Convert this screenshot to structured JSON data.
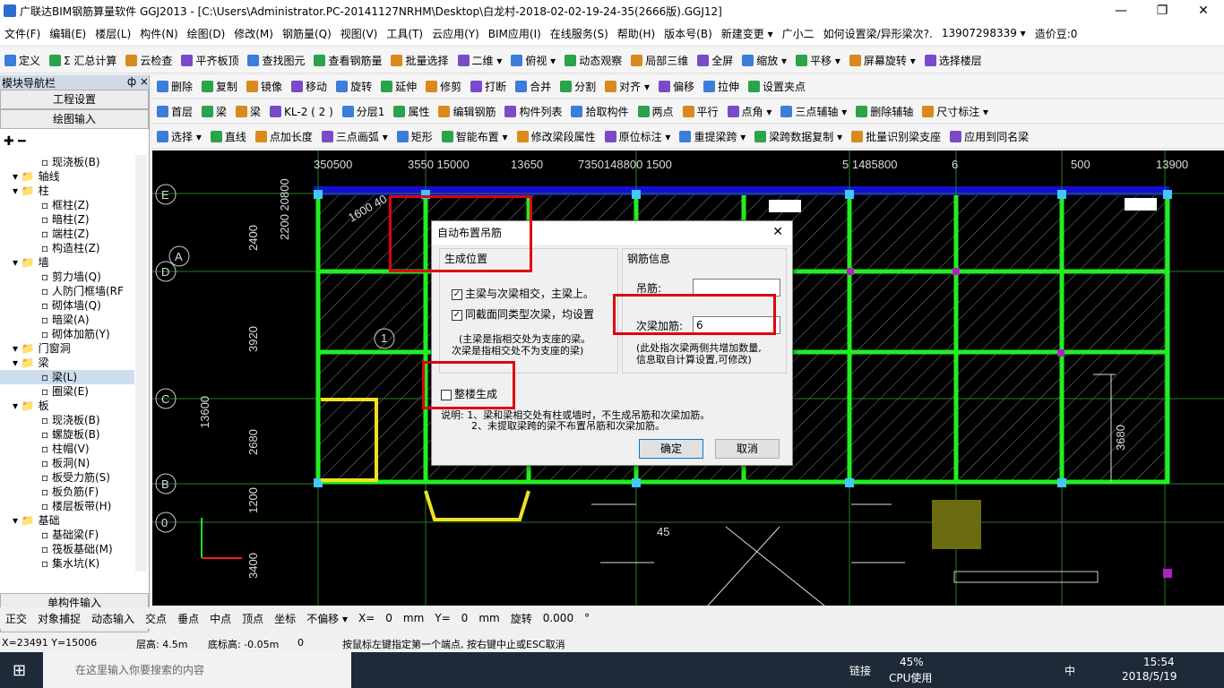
{
  "window": {
    "title": "广联达BIM钢筋算量软件 GGJ2013 - [C:\\Users\\Administrator.PC-20141127NRHM\\Desktop\\白龙村-2018-02-02-19-24-35(2666版).GGJ12]"
  },
  "menu": [
    "文件(F)",
    "编辑(E)",
    "楼层(L)",
    "构件(N)",
    "绘图(D)",
    "修改(M)",
    "钢筋量(Q)",
    "视图(V)",
    "工具(T)",
    "云应用(Y)",
    "BIM应用(I)",
    "在线服务(S)",
    "帮助(H)",
    "版本号(B)",
    "新建变更 ▾",
    "广小二",
    "如何设置梁/异形梁次?.",
    "13907298339 ▾",
    "造价豆:0"
  ],
  "toolbar1": [
    "定义",
    "Σ 汇总计算",
    "云检查",
    "平齐板顶",
    "查找图元",
    "查看钢筋量",
    "批量选择",
    "二维 ▾",
    "俯视 ▾",
    "动态观察",
    "局部三维",
    "全屏",
    "缩放 ▾",
    "平移 ▾",
    "屏幕旋转 ▾",
    "选择楼层"
  ],
  "toolbar2": [
    "删除",
    "复制",
    "镜像",
    "移动",
    "旋转",
    "延伸",
    "修剪",
    "打断",
    "合并",
    "分割",
    "对齐 ▾",
    "偏移",
    "拉伸",
    "设置夹点"
  ],
  "toolbar3": [
    "首层",
    "梁",
    "梁",
    "KL-2 ( 2 )",
    "分层1",
    "属性",
    "编辑钢筋",
    "构件列表",
    "拾取构件",
    "两点",
    "平行",
    "点角 ▾",
    "三点辅轴 ▾",
    "删除辅轴",
    "尺寸标注 ▾"
  ],
  "toolbar4": [
    "选择 ▾",
    "直线",
    "点加长度",
    "三点画弧 ▾",
    "矩形",
    "智能布置 ▾",
    "修改梁段属性",
    "原位标注 ▾",
    "重提梁跨 ▾",
    "梁跨数据复制 ▾",
    "批量识别梁支座",
    "应用到同名梁"
  ],
  "nav": {
    "title": "模块导航栏",
    "pin": "ф ×",
    "btn1": "工程设置",
    "btn2": "绘图输入",
    "tree": [
      "现浇板(B)",
      "轴线",
      "柱",
      "框柱(Z)",
      "暗柱(Z)",
      "端柱(Z)",
      "构造柱(Z)",
      "墙",
      "剪力墙(Q)",
      "人防门框墙(RF",
      "砌体墙(Q)",
      "暗梁(A)",
      "砌体加筋(Y)",
      "门窗洞",
      "梁",
      "梁(L)",
      "圈梁(E)",
      "板",
      "现浇板(B)",
      "螺旋板(B)",
      "柱帽(V)",
      "板洞(N)",
      "板受力筋(S)",
      "板负筋(F)",
      "楼层板带(H)",
      "基础",
      "基础梁(F)",
      "筏板基础(M)",
      "集水坑(K)"
    ],
    "btn3": "单构件输入",
    "btn4": "报表预览"
  },
  "dialog": {
    "title": "自动布置吊筋",
    "group1": "生成位置",
    "chk1": "主梁与次梁相交，主梁上。",
    "chk2": "同截面同类型次梁，均设置",
    "note1": "(主梁是指相交处为支座的梁。",
    "note1b": "次梁是指相交处不为支座的梁)",
    "chk3": "整楼生成",
    "group2": "钢筋信息",
    "label_diaojin": "吊筋:",
    "value_diaojin": "",
    "label_cijia": "次梁加筋:",
    "value_cijia": "6",
    "note2": "(此处指次梁两侧共增加数量,",
    "note2b": "信息取自计算设置,可修改)",
    "explain1": "说明: 1、梁和梁相交处有柱或墙时，不生成吊筋和次梁加筋。",
    "explain2": "2、未提取梁跨的梁不布置吊筋和次梁加筋。",
    "ok": "确定",
    "cancel": "取消"
  },
  "status": [
    "正交",
    "对象捕捉",
    "动态输入",
    "交点",
    "垂点",
    "中点",
    "顶点",
    "坐标",
    "不偏移 ▾",
    "X=",
    "0",
    "mm",
    "Y=",
    "0",
    "mm",
    "旋转",
    "0.000",
    "°"
  ],
  "coord": {
    "xy": "X=23491 Y=15006",
    "floor": "层高: 4.5m",
    "base": "底标高: -0.05m",
    "zero": "0",
    "hint": "按鼠标左键指定第一个端点, 按右键中止或ESC取消"
  },
  "taskbar": {
    "search": "在这里输入你要搜索的内容",
    "cpu_pct": "45%",
    "cpu_label": "CPU使用",
    "link": "链接",
    "ime": "中",
    "time": "15:54",
    "date": "2018/5/19"
  },
  "cad": {
    "top_labels": [
      "350500",
      "3550 15000",
      "13650",
      "7350148800 1500",
      "5 1485800",
      "6",
      "500",
      "13900"
    ],
    "axis_left": [
      "E",
      "D",
      "C",
      "B",
      "0"
    ],
    "axis_a": "A",
    "dims": [
      "2400",
      "3920",
      "2680",
      "1200",
      "3400",
      "13600",
      "2200 20800",
      "3680",
      "45",
      "1600 40"
    ],
    "circle": "1"
  }
}
